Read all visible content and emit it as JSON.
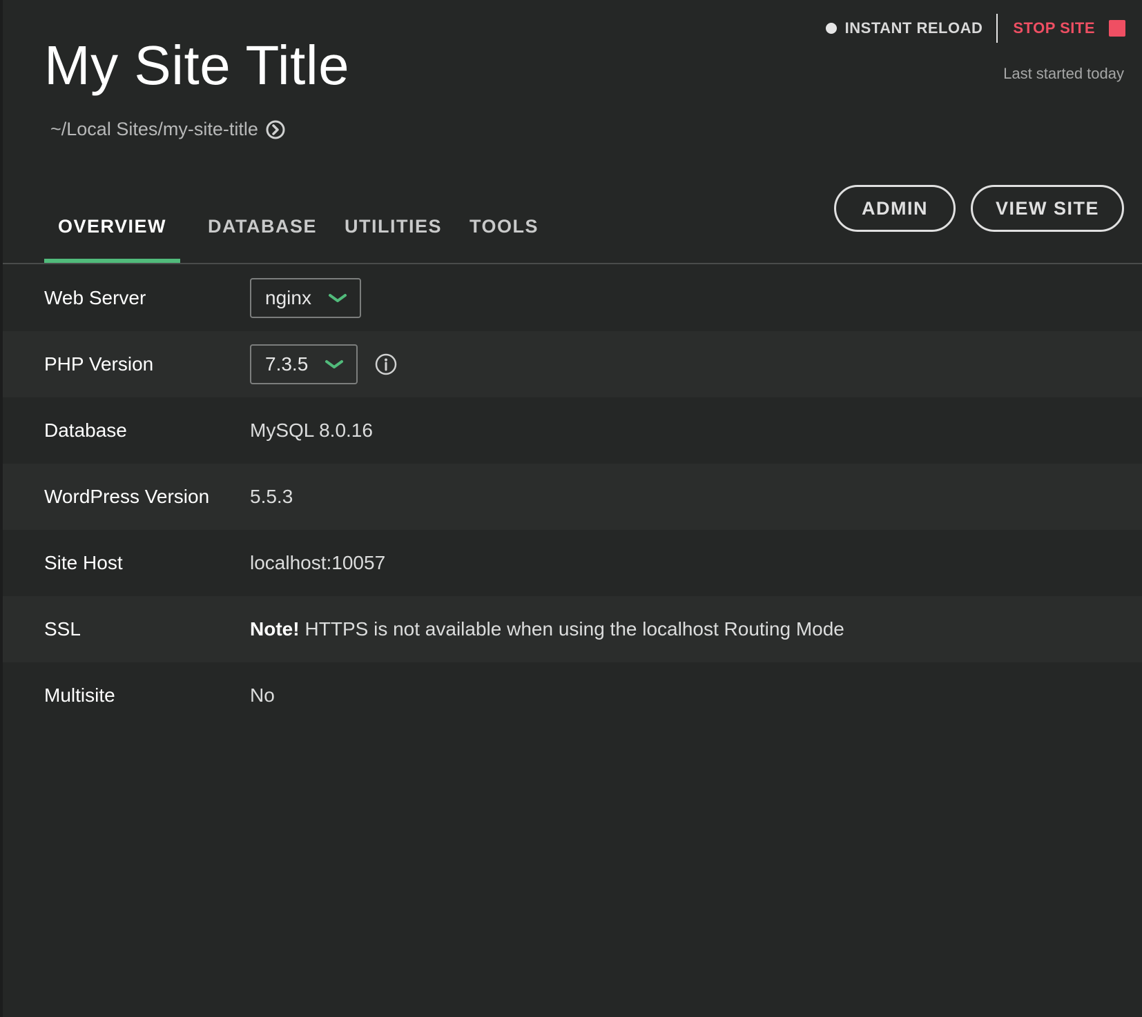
{
  "header": {
    "site_title": "My Site Title",
    "site_path": "~/Local Sites/my-site-title",
    "instant_reload_label": "INSTANT RELOAD",
    "stop_site_label": "STOP SITE",
    "last_started": "Last started today",
    "admin_label": "ADMIN",
    "view_site_label": "VIEW SITE"
  },
  "tabs": [
    {
      "label": "OVERVIEW",
      "active": true
    },
    {
      "label": "DATABASE",
      "active": false
    },
    {
      "label": "UTILITIES",
      "active": false
    },
    {
      "label": "TOOLS",
      "active": false
    }
  ],
  "overview": {
    "web_server": {
      "label": "Web Server",
      "value": "nginx"
    },
    "php_version": {
      "label": "PHP Version",
      "value": "7.3.5"
    },
    "database": {
      "label": "Database",
      "value": "MySQL 8.0.16"
    },
    "wordpress_version": {
      "label": "WordPress Version",
      "value": "5.5.3"
    },
    "site_host": {
      "label": "Site Host",
      "value": "localhost:10057"
    },
    "ssl": {
      "label": "SSL",
      "note_prefix": "Note!",
      "value": "HTTPS is not available when using the localhost Routing Mode"
    },
    "multisite": {
      "label": "Multisite",
      "value": "No"
    }
  },
  "colors": {
    "accent_green": "#51bb7b",
    "stop_red": "#ef4f63",
    "background": "#252726"
  },
  "icons": {
    "path_reveal": "circle-arrow-right-icon",
    "select_caret": "chevron-down-icon",
    "php_info": "info-icon",
    "reload_status": "status-dot-icon",
    "stop": "stop-square-icon"
  }
}
